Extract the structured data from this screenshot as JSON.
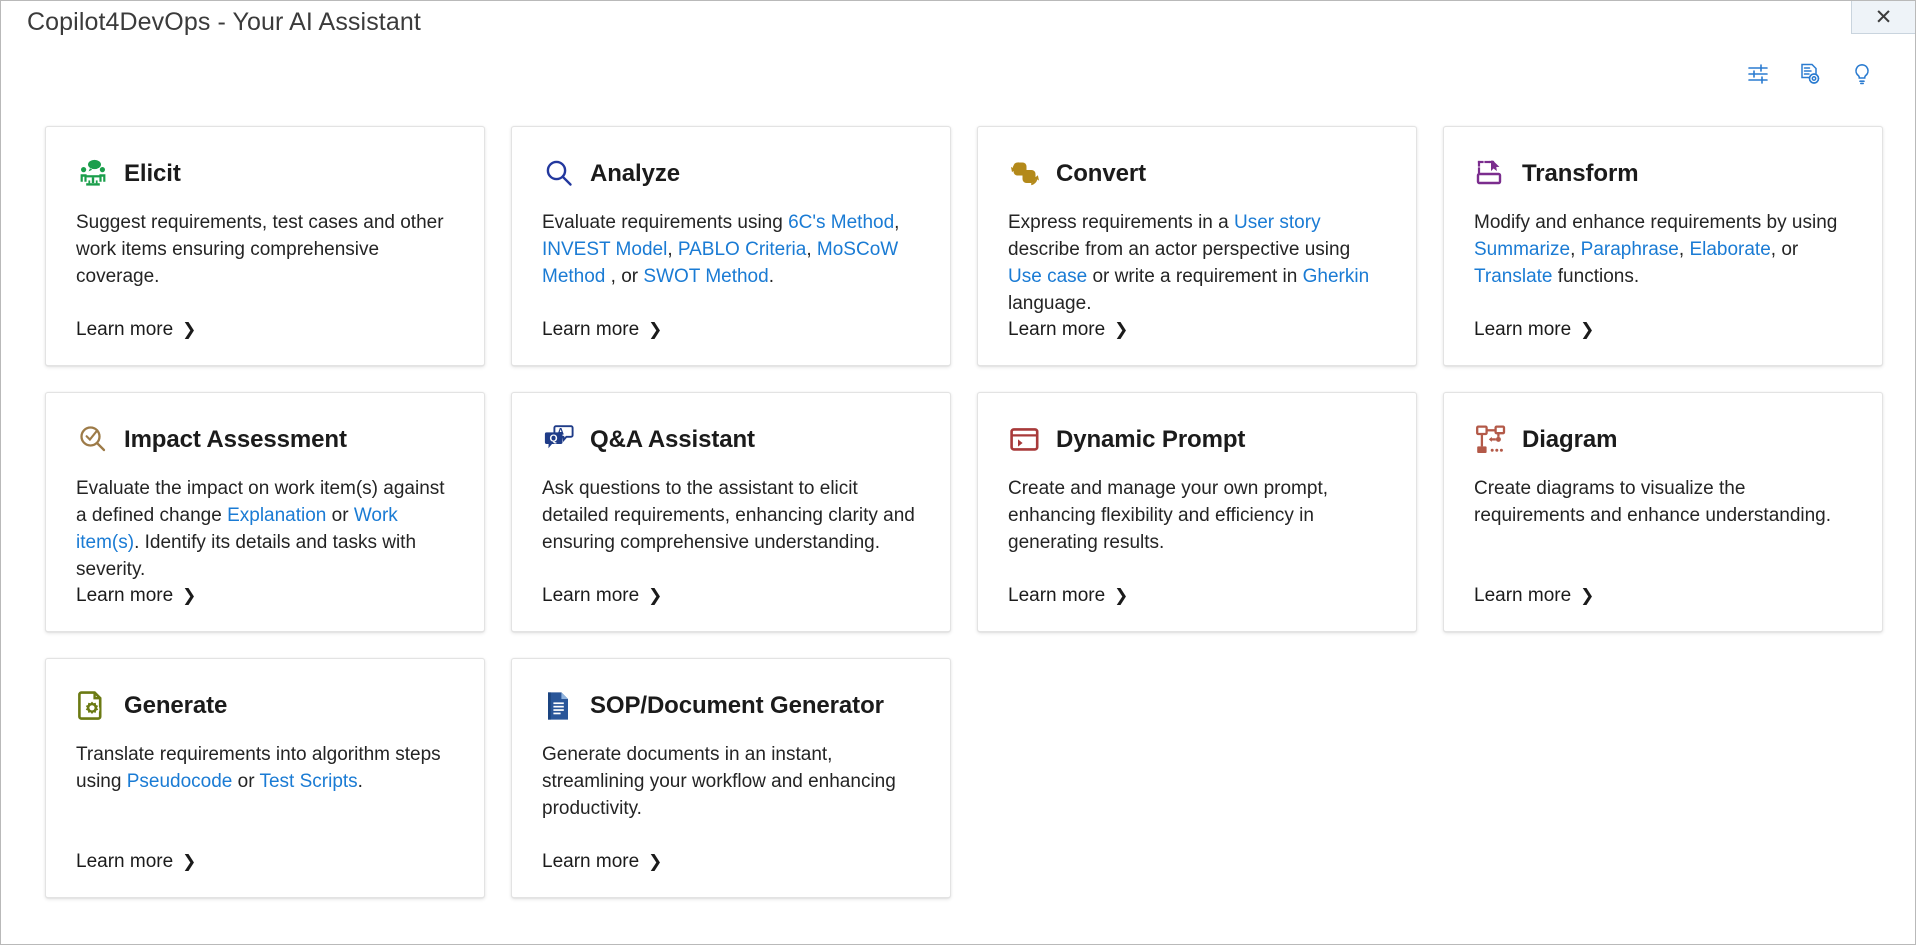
{
  "window": {
    "title": "Copilot4DevOps - Your AI Assistant",
    "close_label": "✕"
  },
  "toolbar": {
    "items": [
      {
        "name": "settings-sliders-icon",
        "label": "Settings"
      },
      {
        "name": "document-settings-icon",
        "label": "Document Settings"
      },
      {
        "name": "lightbulb-icon",
        "label": "Tips"
      }
    ],
    "accent_color": "#2a7bd0"
  },
  "common": {
    "learn_more": "Learn more",
    "chevron": "❯",
    "link_color": "#1a7bd4"
  },
  "cards": [
    {
      "id": "elicit",
      "title": "Elicit",
      "icon": "people-meeting-icon",
      "icon_color": "#1a9e4b",
      "desc_parts": [
        {
          "t": "Suggest requirements, test cases and other work items ensuring comprehensive coverage.",
          "link": false
        }
      ]
    },
    {
      "id": "analyze",
      "title": "Analyze",
      "icon": "magnifier-icon",
      "icon_color": "#23389e",
      "desc_parts": [
        {
          "t": "Evaluate requirements using ",
          "link": false
        },
        {
          "t": "6C's Method",
          "link": true
        },
        {
          "t": ", ",
          "link": false
        },
        {
          "t": "INVEST Model",
          "link": true
        },
        {
          "t": ", ",
          "link": false
        },
        {
          "t": "PABLO Criteria",
          "link": true
        },
        {
          "t": ", ",
          "link": false
        },
        {
          "t": "MoSCoW Method",
          "link": true
        },
        {
          "t": " , or ",
          "link": false
        },
        {
          "t": "SWOT Method",
          "link": true
        },
        {
          "t": ".",
          "link": false
        }
      ]
    },
    {
      "id": "convert",
      "title": "Convert",
      "icon": "convert-arrows-icon",
      "icon_color": "#b3891a",
      "desc_parts": [
        {
          "t": "Express requirements in a ",
          "link": false
        },
        {
          "t": "User story",
          "link": true
        },
        {
          "t": "  describe from an actor perspective using ",
          "link": false
        },
        {
          "t": "Use case",
          "link": true
        },
        {
          "t": "  or write a requirement in ",
          "link": false
        },
        {
          "t": "Gherkin",
          "link": true
        },
        {
          "t": "  language.",
          "link": false
        }
      ]
    },
    {
      "id": "transform",
      "title": "Transform",
      "icon": "transform-icon",
      "icon_color": "#7b2d8e",
      "desc_parts": [
        {
          "t": "Modify and enhance requirements by using ",
          "link": false
        },
        {
          "t": "Summarize",
          "link": true
        },
        {
          "t": ", ",
          "link": false
        },
        {
          "t": "Paraphrase",
          "link": true
        },
        {
          "t": ", ",
          "link": false
        },
        {
          "t": "Elaborate",
          "link": true
        },
        {
          "t": ", or ",
          "link": false
        },
        {
          "t": "Translate",
          "link": true
        },
        {
          "t": " functions.",
          "link": false
        }
      ]
    },
    {
      "id": "impact-assessment",
      "title": "Impact Assessment",
      "icon": "magnifier-check-icon",
      "icon_color": "#9d7b48",
      "desc_parts": [
        {
          "t": "Evaluate the impact on work item(s) against a defined change ",
          "link": false
        },
        {
          "t": "Explanation",
          "link": true
        },
        {
          "t": " or ",
          "link": false
        },
        {
          "t": "Work item(s)",
          "link": true
        },
        {
          "t": ". Identify its details and tasks with severity.",
          "link": false
        }
      ]
    },
    {
      "id": "qa-assistant",
      "title": "Q&A Assistant",
      "icon": "qa-bubbles-icon",
      "icon_color": "#1f3c88",
      "desc_parts": [
        {
          "t": "Ask questions to the assistant to elicit detailed requirements, enhancing clarity and ensuring comprehensive understanding.",
          "link": false
        }
      ]
    },
    {
      "id": "dynamic-prompt",
      "title": "Dynamic Prompt",
      "icon": "console-window-icon",
      "icon_color": "#a83a3a",
      "desc_parts": [
        {
          "t": "Create and manage your own prompt, enhancing flexibility and efficiency in generating results.",
          "link": false
        }
      ]
    },
    {
      "id": "diagram",
      "title": "Diagram",
      "icon": "flowchart-icon",
      "icon_color": "#b35948",
      "desc_parts": [
        {
          "t": "Create diagrams to visualize the requirements and enhance understanding.",
          "link": false
        }
      ]
    },
    {
      "id": "generate",
      "title": "Generate",
      "icon": "document-gear-icon",
      "icon_color": "#6b7a13",
      "desc_parts": [
        {
          "t": "Translate requirements into algorithm steps using ",
          "link": false
        },
        {
          "t": "Pseudocode",
          "link": true
        },
        {
          "t": " or ",
          "link": false
        },
        {
          "t": "Test Scripts",
          "link": true
        },
        {
          "t": ".",
          "link": false
        }
      ]
    },
    {
      "id": "sop-document-generator",
      "title": "SOP/Document Generator",
      "icon": "document-lines-icon",
      "icon_color": "#2a5699",
      "desc_parts": [
        {
          "t": "Generate documents in an instant, streamlining your workflow and enhancing productivity.",
          "link": false
        }
      ]
    }
  ]
}
